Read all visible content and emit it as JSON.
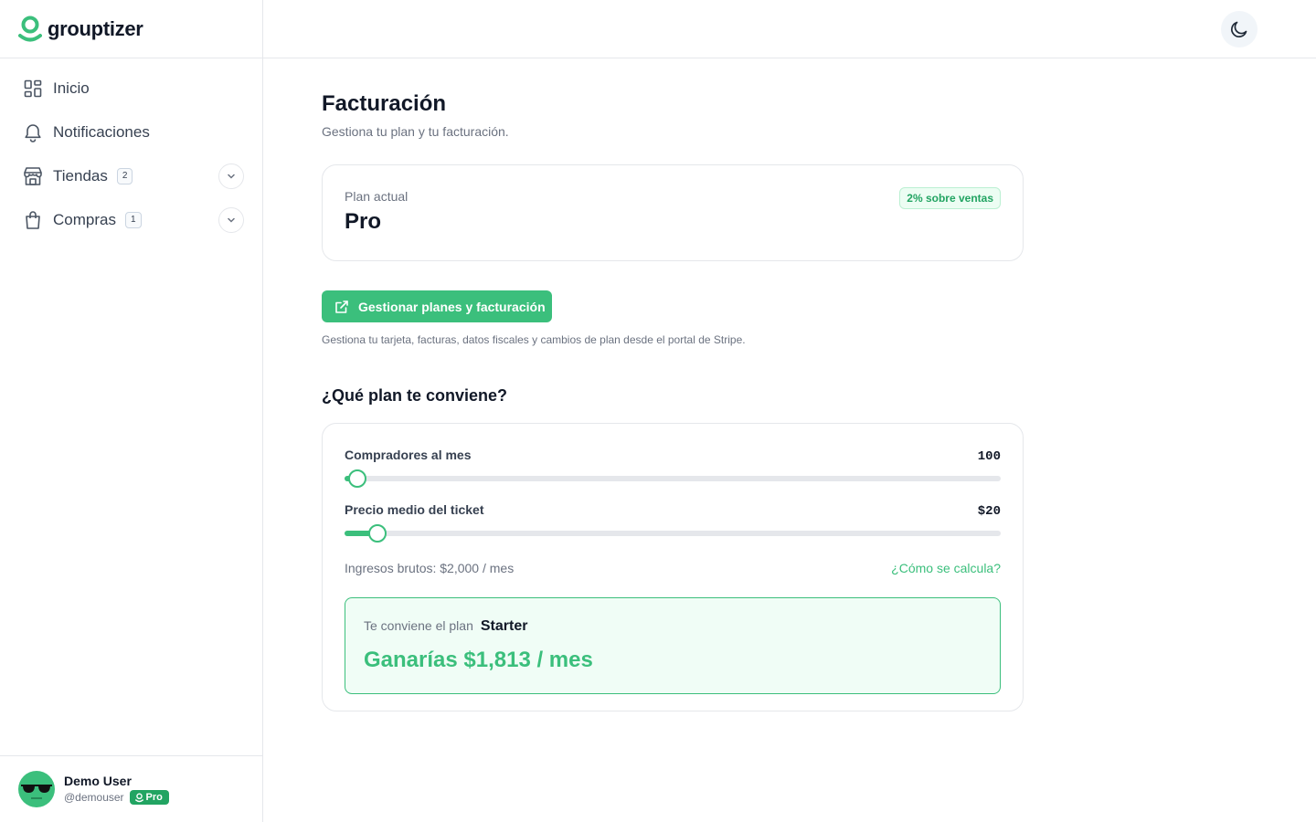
{
  "app": {
    "name": "grouptizer"
  },
  "sidebar": {
    "items": [
      {
        "label": "Inicio",
        "icon": "dashboard-icon"
      },
      {
        "label": "Notificaciones",
        "icon": "bell-icon"
      },
      {
        "label": "Tiendas",
        "icon": "store-icon",
        "count": "2"
      },
      {
        "label": "Compras",
        "icon": "shopping-bag-icon",
        "count": "1"
      }
    ]
  },
  "user": {
    "name": "Demo User",
    "handle": "@demouser",
    "badge": "Pro"
  },
  "page": {
    "title": "Facturación",
    "subtitle": "Gestiona tu plan y tu facturación."
  },
  "plan": {
    "label": "Plan actual",
    "name": "Pro",
    "fee_badge": "2% sobre ventas"
  },
  "manage": {
    "button_label": "Gestionar planes y facturación",
    "note": "Gestiona tu tarjeta, facturas, datos fiscales y cambios de plan desde el portal de Stripe."
  },
  "calculator": {
    "title": "¿Qué plan te conviene?",
    "buyers": {
      "label": "Compradores al mes",
      "value": "100",
      "fraction": 0.02
    },
    "ticket": {
      "label": "Precio medio del ticket",
      "value": "$20",
      "fraction": 0.05
    },
    "gross": "Ingresos brutos: $2,000 / mes",
    "how_link": "¿Cómo se calcula?",
    "result": {
      "prefix": "Te conviene el plan",
      "plan": "Starter",
      "earnings": "Ganarías $1,813 / mes"
    }
  },
  "colors": {
    "accent": "#3bbf7c",
    "accent_dark": "#22a462"
  }
}
